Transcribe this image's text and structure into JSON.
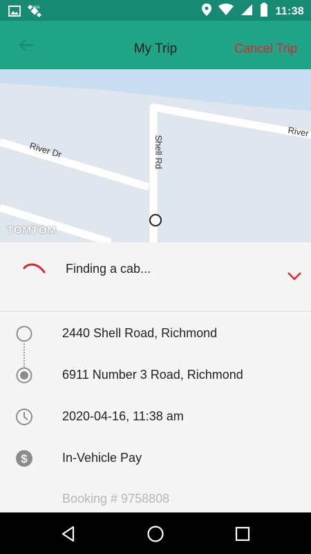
{
  "status_bar": {
    "time": "11:38",
    "icons": [
      "image-icon",
      "satellite-icon",
      "location-icon",
      "wifi-icon",
      "signal-icon",
      "battery-icon"
    ]
  },
  "header": {
    "title": "My Trip",
    "cancel_label": "Cancel Trip",
    "back_icon": "arrow-left-icon"
  },
  "map": {
    "labels": {
      "river_dr": "River Dr",
      "shell_rd": "Shell Rd",
      "river_right": "River"
    },
    "attribution": "TOMTOM"
  },
  "trip_status": {
    "text": "Finding a cab...",
    "accent": "#e3222b"
  },
  "details": {
    "pickup": "2440 Shell Road, Richmond",
    "dropoff": "6911 Number 3 Road, Richmond",
    "datetime": "2020-04-16, 11:38 am",
    "payment": "In-Vehicle Pay",
    "booking": "Booking # 9758808"
  },
  "colors": {
    "appbar": "#1fa488",
    "statusbar": "#168a72",
    "accent": "#e3222b",
    "water": "#c9dff1",
    "land": "#dfe6ee"
  }
}
